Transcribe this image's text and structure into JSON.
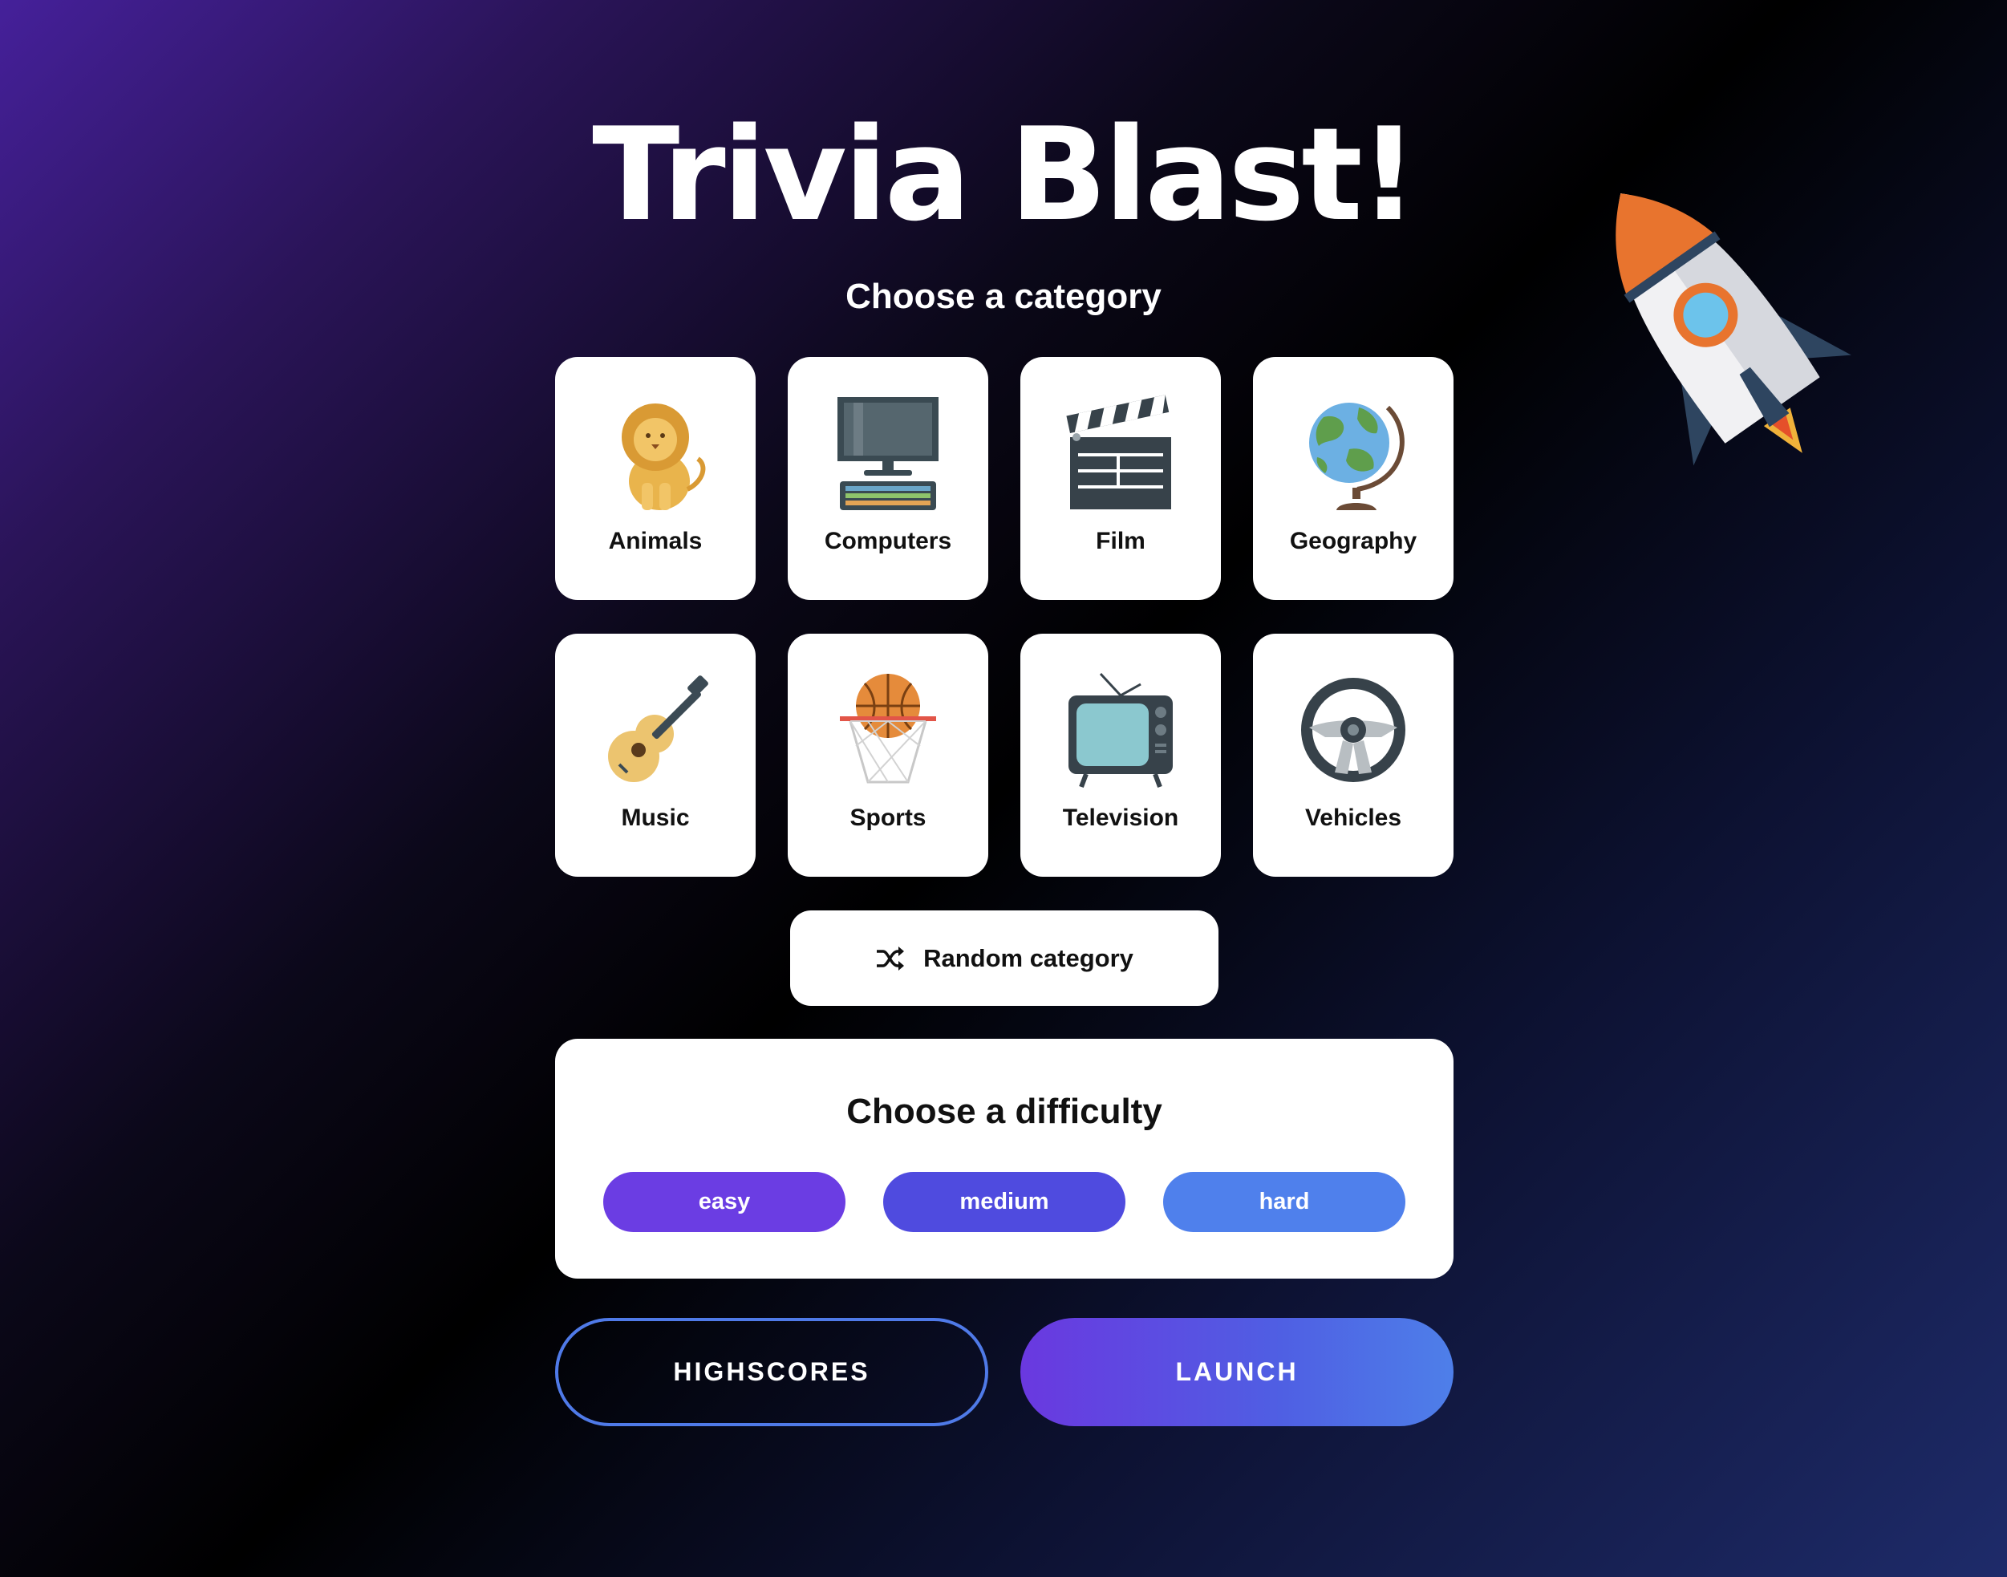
{
  "app": {
    "title": "Trivia Blast!"
  },
  "category_section": {
    "heading": "Choose a category",
    "categories": [
      {
        "label": "Animals",
        "icon": "lion-icon"
      },
      {
        "label": "Computers",
        "icon": "computer-icon"
      },
      {
        "label": "Film",
        "icon": "clapperboard-icon"
      },
      {
        "label": "Geography",
        "icon": "globe-icon"
      },
      {
        "label": "Music",
        "icon": "guitar-icon"
      },
      {
        "label": "Sports",
        "icon": "basketball-hoop-icon"
      },
      {
        "label": "Television",
        "icon": "tv-icon"
      },
      {
        "label": "Vehicles",
        "icon": "steering-wheel-icon"
      }
    ],
    "random_button": {
      "label": "Random category",
      "icon": "shuffle-icon"
    }
  },
  "difficulty_section": {
    "heading": "Choose a difficulty",
    "options": [
      {
        "label": "easy",
        "color": "#6b3de3"
      },
      {
        "label": "medium",
        "color": "#4f4bdf"
      },
      {
        "label": "hard",
        "color": "#4f80ec"
      }
    ]
  },
  "actions": {
    "highscores_label": "HIGHSCORES",
    "launch_label": "LAUNCH"
  },
  "decor": {
    "rocket_icon": "rocket-icon"
  }
}
